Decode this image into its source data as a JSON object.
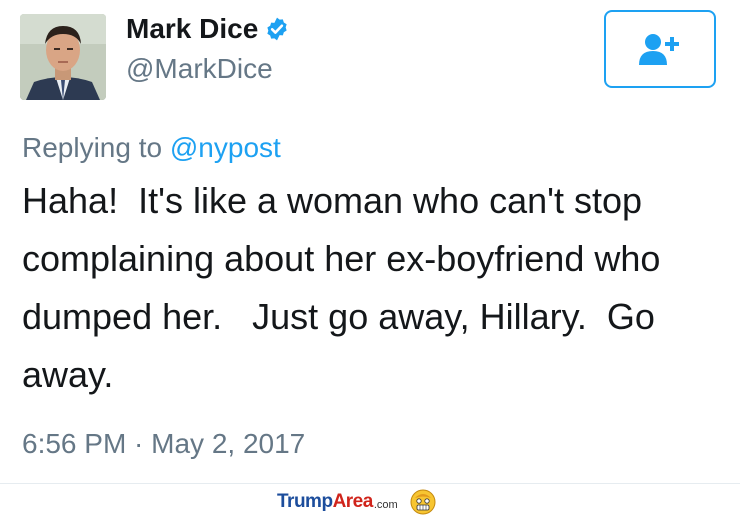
{
  "author": {
    "display_name": "Mark Dice",
    "handle": "@MarkDice",
    "verified": true
  },
  "follow_button": {
    "icon": "add-user-icon"
  },
  "reply": {
    "prefix": "Replying to",
    "mention": "@nypost"
  },
  "tweet": {
    "text": "Haha!  It's like a woman who can't stop complaining about her ex-boyfriend who dumped her.   Just go away, Hillary.  Go away.",
    "timestamp": "6:56 PM · May 2, 2017"
  },
  "watermark": {
    "brand_part1": "Trump",
    "brand_part2": "Area",
    "brand_suffix": ".com"
  },
  "colors": {
    "accent": "#1da1f2",
    "muted": "#657786",
    "text": "#14171a"
  }
}
